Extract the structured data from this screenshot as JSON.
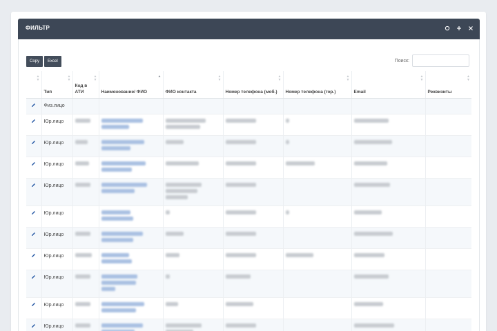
{
  "breadcrumb": "",
  "panel": {
    "title": "ФИЛЬТР",
    "tools": [
      {
        "name": "collapse-icon"
      },
      {
        "name": "expand-icon"
      },
      {
        "name": "close-icon"
      }
    ]
  },
  "toolbar": {
    "copy_label": "Copy",
    "excel_label": "Excel"
  },
  "search": {
    "label": "Поиск:",
    "value": "",
    "placeholder": ""
  },
  "table": {
    "columns": [
      {
        "label": ""
      },
      {
        "label": "Тип"
      },
      {
        "label": "Код в АТИ"
      },
      {
        "label": "Наименование/ ФИО"
      },
      {
        "label": "ФИО контакта"
      },
      {
        "label": "Номер телефона (моб.)"
      },
      {
        "label": "Номер телефона (гор.)"
      },
      {
        "label": "Email"
      },
      {
        "label": "Реквизиты"
      }
    ],
    "rows": [
      {
        "type": "Физ.лицо"
      },
      {
        "type": "Юр.лицо"
      },
      {
        "type": "Юр.лицо"
      },
      {
        "type": "Юр.лицо"
      },
      {
        "type": "Юр.лицо"
      },
      {
        "type": "Юр.лицо"
      },
      {
        "type": "Юр.лицо"
      },
      {
        "type": "Юр.лицо"
      },
      {
        "type": "Юр.лицо"
      },
      {
        "type": "Юр.лицо"
      },
      {
        "type": "Юр.лицо"
      }
    ]
  },
  "colors": {
    "header_bg": "#3d4756",
    "button_bg": "#434d5b",
    "link": "#7fa3d6",
    "edit_icon": "#2e5fa8"
  }
}
